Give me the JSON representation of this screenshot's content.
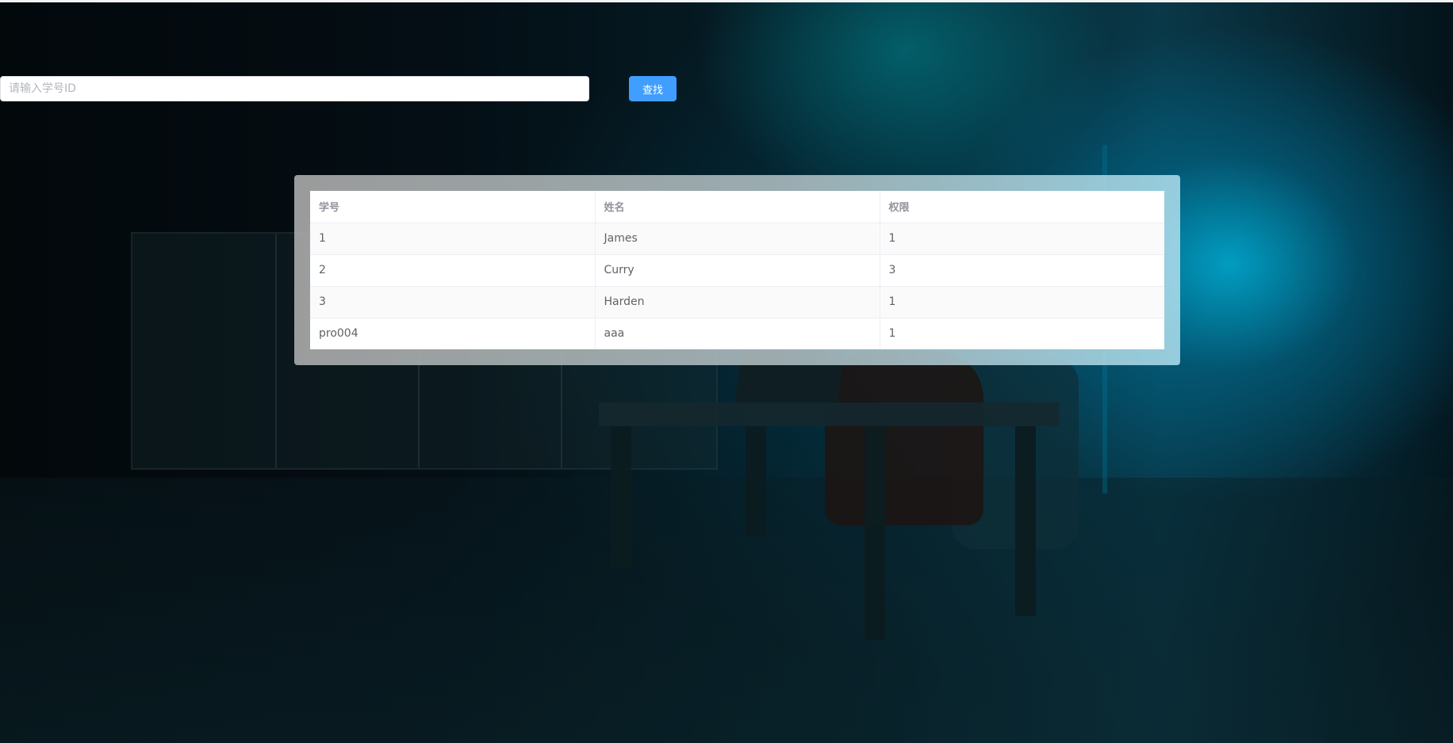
{
  "search": {
    "placeholder": "请输入学号ID",
    "value": "",
    "button_label": "查找"
  },
  "table": {
    "columns": [
      "学号",
      "姓名",
      "权限"
    ],
    "rows": [
      [
        "1",
        "James",
        "1"
      ],
      [
        "2",
        "Curry",
        "3"
      ],
      [
        "3",
        "Harden",
        "1"
      ],
      [
        "pro004",
        "aaa",
        "1"
      ]
    ]
  },
  "colors": {
    "primary_button": "#409eff",
    "header_text": "#909399",
    "cell_text": "#606266"
  }
}
